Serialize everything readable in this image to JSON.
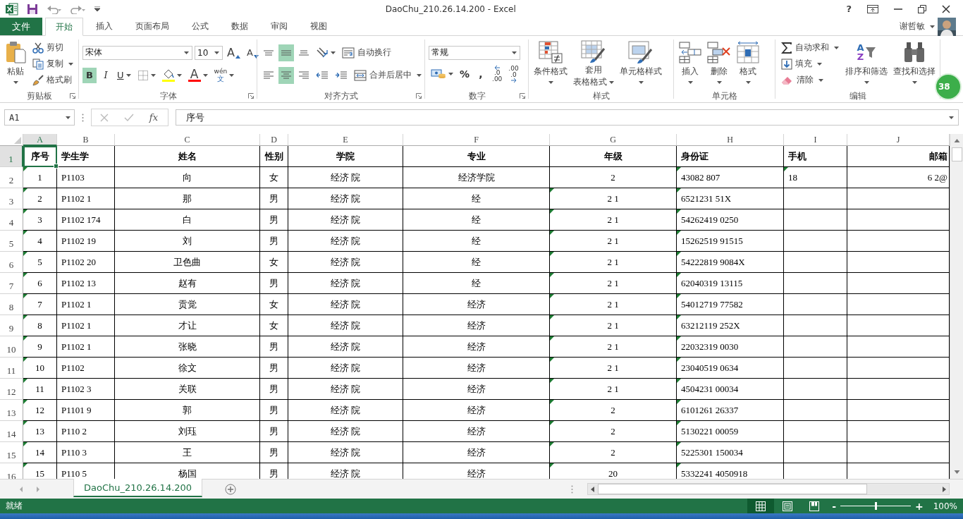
{
  "title_bar": {
    "title": "DaoChu_210.26.14.200 - Excel",
    "help": "?"
  },
  "file_tab": "文件",
  "tabs": [
    {
      "label": "开始",
      "selected": true
    },
    {
      "label": "插入",
      "selected": false
    },
    {
      "label": "页面布局",
      "selected": false
    },
    {
      "label": "公式",
      "selected": false
    },
    {
      "label": "数据",
      "selected": false
    },
    {
      "label": "审阅",
      "selected": false
    },
    {
      "label": "视图",
      "selected": false
    }
  ],
  "account": {
    "user": "谢哲敏"
  },
  "ribbon": {
    "groups": [
      {
        "label": "剪贴板",
        "launcher": true,
        "items": [
          {
            "kind": "big",
            "label": "粘贴",
            "dropdown": true
          },
          {
            "kind": "stack",
            "rows": [
              [
                {
                  "kind": "small",
                  "label": "剪切",
                  "dropdown": false
                }
              ],
              [
                {
                  "kind": "small",
                  "label": "复制",
                  "dropdown": true
                }
              ],
              [
                {
                  "kind": "small",
                  "label": "格式刷",
                  "dropdown": false
                }
              ]
            ]
          }
        ]
      },
      {
        "label": "字体",
        "launcher": true,
        "items": [
          {
            "kind": "stack",
            "rows": [
              [
                {
                  "kind": "combo",
                  "value": "宋体"
                },
                {
                  "kind": "combo",
                  "value": "10"
                },
                {
                  "kind": "icon",
                  "glyph": "A",
                  "dropdown": false
                },
                {
                  "kind": "icon",
                  "glyph": "A",
                  "dropdown": false
                }
              ],
              [
                {
                  "kind": "toggle",
                  "glyph": "B",
                  "selected": true,
                  "dropdown": false
                },
                {
                  "kind": "toggle",
                  "glyph": "I",
                  "selected": false,
                  "dropdown": false
                },
                {
                  "kind": "toggle",
                  "glyph": "U",
                  "selected": false,
                  "dropdown": true
                },
                {
                  "kind": "icon",
                  "dropdown": true
                },
                {
                  "kind": "icon",
                  "dropdown": true
                },
                {
                  "kind": "icon",
                  "glyph": "A",
                  "dropdown": true
                },
                {
                  "kind": "icon",
                  "glyph": "wén",
                  "glyph2": "文",
                  "dropdown": true
                }
              ]
            ]
          }
        ]
      },
      {
        "label": "对齐方式",
        "launcher": true,
        "items": [
          {
            "kind": "stack",
            "rows": [
              [
                {
                  "kind": "icon",
                  "selected": false,
                  "dropdown": false
                },
                {
                  "kind": "icon",
                  "selected": true,
                  "dropdown": false
                },
                {
                  "kind": "icon",
                  "selected": false,
                  "dropdown": false
                },
                {
                  "kind": "icon",
                  "dropdown": true
                },
                {
                  "kind": "small",
                  "label": "自动换行",
                  "dropdown": false
                }
              ],
              [
                {
                  "kind": "icon",
                  "selected": false,
                  "dropdown": false
                },
                {
                  "kind": "icon",
                  "selected": true,
                  "dropdown": false
                },
                {
                  "kind": "icon",
                  "selected": false,
                  "dropdown": false
                },
                {
                  "kind": "icon",
                  "dropdown": false
                },
                {
                  "kind": "icon",
                  "dropdown": false
                },
                {
                  "kind": "small",
                  "label": "合并后居中",
                  "dropdown": true
                }
              ]
            ]
          }
        ]
      },
      {
        "label": "数字",
        "launcher": true,
        "items": [
          {
            "kind": "stack",
            "rows": [
              [
                {
                  "kind": "combo",
                  "value": "常规"
                }
              ],
              [
                {
                  "kind": "icon",
                  "dropdown": true
                },
                {
                  "kind": "toggle",
                  "glyph": "%",
                  "selected": false,
                  "dropdown": false
                },
                {
                  "kind": "toggle",
                  "glyph": ",",
                  "selected": false,
                  "dropdown": false
                },
                {
                  "kind": "icon",
                  "glyph": ".0",
                  "glyph2": ".00",
                  "dropdown": false
                },
                {
                  "kind": "icon",
                  "glyph": ".00",
                  "glyph2": ".0",
                  "dropdown": false
                }
              ]
            ]
          }
        ]
      },
      {
        "label": "样式",
        "launcher": false,
        "items": [
          {
            "kind": "big",
            "label": "条件格式",
            "dropdown": true
          },
          {
            "kind": "big",
            "label": "套用",
            "label2": "表格格式",
            "dropdown": true
          },
          {
            "kind": "big",
            "label": "单元格样式",
            "dropdown": true
          }
        ]
      },
      {
        "label": "单元格",
        "launcher": false,
        "items": [
          {
            "kind": "big",
            "label": "插入",
            "dropdown": true
          },
          {
            "kind": "big",
            "label": "删除",
            "dropdown": true
          },
          {
            "kind": "big",
            "label": "格式",
            "dropdown": true
          }
        ]
      },
      {
        "label": "编辑",
        "launcher": false,
        "items": [
          {
            "kind": "stack",
            "rows": [
              [
                {
                  "kind": "small",
                  "label": "自动求和",
                  "dropdown": true
                }
              ],
              [
                {
                  "kind": "small",
                  "label": "填充",
                  "dropdown": true
                }
              ],
              [
                {
                  "kind": "small",
                  "label": "清除",
                  "dropdown": true
                }
              ]
            ]
          },
          {
            "kind": "big",
            "label": "排序和筛选",
            "glyph": "A",
            "glyph2": "Z",
            "dropdown": true
          },
          {
            "kind": "big",
            "label": "查找和选择",
            "dropdown": true
          }
        ]
      }
    ]
  },
  "widget": {
    "badge": "38"
  },
  "formula_bar": {
    "name_box": "A1",
    "fx": "fx",
    "formula": "序号"
  },
  "columns": [
    {
      "letter": "A",
      "selected": true
    },
    {
      "letter": "B",
      "selected": false
    },
    {
      "letter": "C",
      "selected": false
    },
    {
      "letter": "D",
      "selected": false
    },
    {
      "letter": "E",
      "selected": false
    },
    {
      "letter": "F",
      "selected": false
    },
    {
      "letter": "G",
      "selected": false
    },
    {
      "letter": "H",
      "selected": false
    },
    {
      "letter": "I",
      "selected": false
    },
    {
      "letter": "J",
      "selected": false
    }
  ],
  "rows": [
    {
      "number": "1",
      "kind": "header",
      "selected": true,
      "cells": [
        {
          "text": "序号",
          "flagged": false
        },
        {
          "text": "学生学",
          "flagged": false
        },
        {
          "text": "姓名",
          "flagged": false
        },
        {
          "text": "性别",
          "flagged": false
        },
        {
          "text": "学院",
          "flagged": false
        },
        {
          "text": "专业",
          "flagged": false
        },
        {
          "text": "年级",
          "flagged": false
        },
        {
          "text": "身份证",
          "flagged": false
        },
        {
          "text": "手机",
          "flagged": false
        },
        {
          "text": "邮箱",
          "flagged": false
        }
      ]
    },
    {
      "number": "2",
      "kind": "data",
      "selected": false,
      "cells": [
        {
          "text": "1",
          "flagged": true
        },
        {
          "text": "P1103",
          "flagged": false
        },
        {
          "text": "向",
          "flagged": false
        },
        {
          "text": "女",
          "flagged": false
        },
        {
          "text": "经济 院",
          "flagged": false
        },
        {
          "text": "经济学院",
          "flagged": false
        },
        {
          "text": "2",
          "flagged": false
        },
        {
          "text": "43082 807",
          "flagged": true
        },
        {
          "text": "18",
          "flagged": true
        },
        {
          "text": "6 2@",
          "flagged": false
        }
      ]
    },
    {
      "number": "3",
      "kind": "data",
      "selected": false,
      "cells": [
        {
          "text": "2",
          "flagged": true
        },
        {
          "text": "P1102 1",
          "flagged": false
        },
        {
          "text": "那",
          "flagged": false
        },
        {
          "text": "男",
          "flagged": false
        },
        {
          "text": "经济 院",
          "flagged": false
        },
        {
          "text": "经",
          "flagged": false
        },
        {
          "text": "2 1",
          "flagged": true
        },
        {
          "text": "6521231 51X",
          "flagged": true
        },
        {
          "flagged": false
        },
        {
          "flagged": false
        }
      ]
    },
    {
      "number": "4",
      "kind": "data",
      "selected": false,
      "cells": [
        {
          "text": "3",
          "flagged": true
        },
        {
          "text": "P1102 174",
          "flagged": false
        },
        {
          "text": "白",
          "flagged": false
        },
        {
          "text": "男",
          "flagged": false
        },
        {
          "text": "经济 院",
          "flagged": false
        },
        {
          "text": "经",
          "flagged": false
        },
        {
          "text": "2 1",
          "flagged": true
        },
        {
          "text": "54262419 0250",
          "flagged": true
        },
        {
          "flagged": false
        },
        {
          "flagged": false
        }
      ]
    },
    {
      "number": "5",
      "kind": "data",
      "selected": false,
      "cells": [
        {
          "text": "4",
          "flagged": true
        },
        {
          "text": "P1102 19",
          "flagged": false
        },
        {
          "text": "刘",
          "flagged": false
        },
        {
          "text": "男",
          "flagged": false
        },
        {
          "text": "经济 院",
          "flagged": false
        },
        {
          "text": "经",
          "flagged": false
        },
        {
          "text": "2 1",
          "flagged": true
        },
        {
          "text": "15262519 91515",
          "flagged": true
        },
        {
          "flagged": false
        },
        {
          "flagged": false
        }
      ]
    },
    {
      "number": "6",
      "kind": "data",
      "selected": false,
      "cells": [
        {
          "text": "5",
          "flagged": true
        },
        {
          "text": "P1102 20",
          "flagged": false
        },
        {
          "text": "卫色曲",
          "flagged": false
        },
        {
          "text": "女",
          "flagged": false
        },
        {
          "text": "经济 院",
          "flagged": false
        },
        {
          "text": "经",
          "flagged": false
        },
        {
          "text": "2 1",
          "flagged": true
        },
        {
          "text": "54222819 9084X",
          "flagged": true
        },
        {
          "flagged": false
        },
        {
          "flagged": false
        }
      ]
    },
    {
      "number": "7",
      "kind": "data",
      "selected": false,
      "cells": [
        {
          "text": "6",
          "flagged": true
        },
        {
          "text": "P1102 13",
          "flagged": false
        },
        {
          "text": "赵有",
          "flagged": false
        },
        {
          "text": "男",
          "flagged": false
        },
        {
          "text": "经济 院",
          "flagged": false
        },
        {
          "text": "经",
          "flagged": false
        },
        {
          "text": "2 1",
          "flagged": true
        },
        {
          "text": "62040319 13115",
          "flagged": true
        },
        {
          "flagged": false
        },
        {
          "flagged": false
        }
      ]
    },
    {
      "number": "8",
      "kind": "data",
      "selected": false,
      "cells": [
        {
          "text": "7",
          "flagged": true
        },
        {
          "text": "P1102 1",
          "flagged": false
        },
        {
          "text": "贡觉",
          "flagged": false
        },
        {
          "text": "女",
          "flagged": false
        },
        {
          "text": "经济 院",
          "flagged": false
        },
        {
          "text": "经济",
          "flagged": false
        },
        {
          "text": "2 1",
          "flagged": true
        },
        {
          "text": "54012719 77582",
          "flagged": true
        },
        {
          "flagged": false
        },
        {
          "flagged": false
        }
      ]
    },
    {
      "number": "9",
      "kind": "data",
      "selected": false,
      "cells": [
        {
          "text": "8",
          "flagged": true
        },
        {
          "text": "P1102 1",
          "flagged": false
        },
        {
          "text": "才让",
          "flagged": false
        },
        {
          "text": "女",
          "flagged": false
        },
        {
          "text": "经济 院",
          "flagged": false
        },
        {
          "text": "经济",
          "flagged": false
        },
        {
          "text": "2 1",
          "flagged": true
        },
        {
          "text": "63212119 252X",
          "flagged": true
        },
        {
          "flagged": false
        },
        {
          "flagged": false
        }
      ]
    },
    {
      "number": "10",
      "kind": "data",
      "selected": false,
      "cells": [
        {
          "text": "9",
          "flagged": true
        },
        {
          "text": "P1102 1",
          "flagged": false
        },
        {
          "text": "张晓",
          "flagged": false
        },
        {
          "text": "男",
          "flagged": false
        },
        {
          "text": "经济 院",
          "flagged": false
        },
        {
          "text": "经济",
          "flagged": false
        },
        {
          "text": "2 1",
          "flagged": true
        },
        {
          "text": "22032319 0030",
          "flagged": true
        },
        {
          "flagged": false
        },
        {
          "flagged": false
        }
      ]
    },
    {
      "number": "11",
      "kind": "data",
      "selected": false,
      "cells": [
        {
          "text": "10",
          "flagged": true
        },
        {
          "text": "P1102",
          "flagged": false
        },
        {
          "text": "徐文",
          "flagged": false
        },
        {
          "text": "男",
          "flagged": false
        },
        {
          "text": "经济 院",
          "flagged": false
        },
        {
          "text": "经济",
          "flagged": false
        },
        {
          "text": "2 1",
          "flagged": true
        },
        {
          "text": "23040519 0634",
          "flagged": true
        },
        {
          "flagged": false
        },
        {
          "flagged": false
        }
      ]
    },
    {
      "number": "12",
      "kind": "data",
      "selected": false,
      "cells": [
        {
          "text": "11",
          "flagged": true
        },
        {
          "text": "P1102 3",
          "flagged": false
        },
        {
          "text": "关联",
          "flagged": false
        },
        {
          "text": "男",
          "flagged": false
        },
        {
          "text": "经济 院",
          "flagged": false
        },
        {
          "text": "经济",
          "flagged": false
        },
        {
          "text": "2 1",
          "flagged": true
        },
        {
          "text": "4504231 00034",
          "flagged": true
        },
        {
          "flagged": false
        },
        {
          "flagged": false
        }
      ]
    },
    {
      "number": "13",
      "kind": "data",
      "selected": false,
      "cells": [
        {
          "text": "12",
          "flagged": true
        },
        {
          "text": "P1101 9",
          "flagged": false
        },
        {
          "text": "郭",
          "flagged": false
        },
        {
          "text": "男",
          "flagged": false
        },
        {
          "text": "经济 院",
          "flagged": false
        },
        {
          "text": "经济",
          "flagged": false
        },
        {
          "text": "2",
          "flagged": true
        },
        {
          "text": "6101261 26337",
          "flagged": true
        },
        {
          "flagged": false
        },
        {
          "flagged": false
        }
      ]
    },
    {
      "number": "14",
      "kind": "data",
      "selected": false,
      "cells": [
        {
          "text": "13",
          "flagged": true
        },
        {
          "text": "P110 2",
          "flagged": false
        },
        {
          "text": "刘珏",
          "flagged": false
        },
        {
          "text": "男",
          "flagged": false
        },
        {
          "text": "经济 院",
          "flagged": false
        },
        {
          "text": "经济",
          "flagged": false
        },
        {
          "text": "2",
          "flagged": true
        },
        {
          "text": "5130221 00059",
          "flagged": true
        },
        {
          "flagged": false
        },
        {
          "flagged": false
        }
      ]
    },
    {
      "number": "15",
      "kind": "data",
      "selected": false,
      "cells": [
        {
          "text": "14",
          "flagged": true
        },
        {
          "text": "P110 3",
          "flagged": false
        },
        {
          "text": "王",
          "flagged": false
        },
        {
          "text": "男",
          "flagged": false
        },
        {
          "text": "经济 院",
          "flagged": false
        },
        {
          "text": "经济",
          "flagged": false
        },
        {
          "text": "2",
          "flagged": true
        },
        {
          "text": "5225301 150034",
          "flagged": true
        },
        {
          "flagged": false
        },
        {
          "flagged": false
        }
      ]
    },
    {
      "number": "16",
      "kind": "data",
      "selected": false,
      "cells": [
        {
          "text": "15",
          "flagged": true
        },
        {
          "text": "P110 5",
          "flagged": false
        },
        {
          "text": "杨国",
          "flagged": false
        },
        {
          "text": "男",
          "flagged": false
        },
        {
          "text": "经济 院",
          "flagged": false
        },
        {
          "text": "经济",
          "flagged": false
        },
        {
          "text": "20",
          "flagged": true
        },
        {
          "text": "5332241 4050918",
          "flagged": true
        },
        {
          "flagged": false
        },
        {
          "flagged": false
        }
      ]
    }
  ],
  "sheet_tabs": [
    {
      "label": "DaoChu_210.26.14.200",
      "selected": true
    }
  ],
  "status_bar": {
    "status": "就绪",
    "views": [
      {
        "selected": true
      },
      {
        "selected": false
      },
      {
        "selected": false
      }
    ],
    "zoom": {
      "minus": "-",
      "plus": "+",
      "level": 0.5,
      "label": "100%"
    }
  }
}
